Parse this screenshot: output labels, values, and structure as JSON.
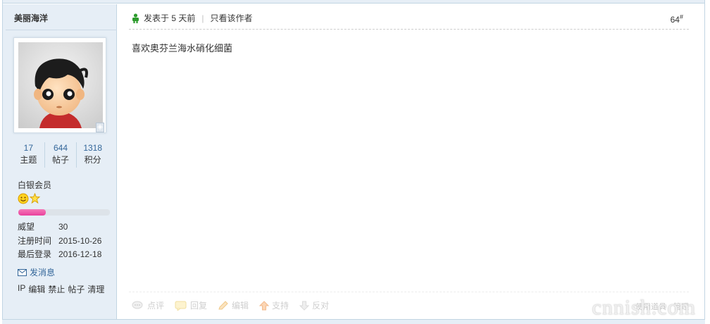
{
  "author": {
    "name": "美丽海洋",
    "stats": [
      {
        "value": "17",
        "label": "主题"
      },
      {
        "value": "644",
        "label": "帖子"
      },
      {
        "value": "1318",
        "label": "积分"
      }
    ],
    "group": "白银会员",
    "credit_progress": 0.3,
    "info": [
      {
        "key": "威望",
        "value": "30"
      },
      {
        "key": "注册时间",
        "value": "2015-10-26"
      },
      {
        "key": "最后登录",
        "value": "2016-12-18"
      }
    ],
    "send_message": "发消息",
    "mod_actions": [
      "IP",
      "编辑",
      "禁止",
      "帖子",
      "清理"
    ]
  },
  "post": {
    "posted": "发表于 5 天前",
    "only_author": "只看该作者",
    "floor": "64",
    "floor_sup": "#",
    "content": "喜欢奥芬兰海水硝化细菌"
  },
  "actions": {
    "comment": "点评",
    "reply": "回复",
    "edit": "编辑",
    "support": "支持",
    "oppose": "反对"
  },
  "management": {
    "use_tools": "使用道具",
    "manage": "管理"
  },
  "watermark": "cnnish.com",
  "colors": {
    "sidebar_bg": "#e6eef6",
    "border": "#c2d5e3",
    "link": "#336699",
    "credit_fill": "#e9419c"
  }
}
